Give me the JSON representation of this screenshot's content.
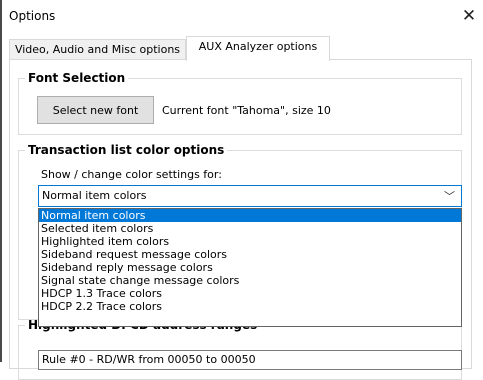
{
  "window": {
    "title": "Options",
    "close_glyph": "✕"
  },
  "tabs": [
    {
      "label": "Video, Audio and Misc options",
      "active": false
    },
    {
      "label": "AUX Analyzer options",
      "active": true
    }
  ],
  "font_selection": {
    "legend": "Font Selection",
    "button_label": "Select new font",
    "current_font_text": "Current font \"Tahoma\", size 10"
  },
  "color_options": {
    "legend": "Transaction list color options",
    "show_label": "Show / change color settings for:",
    "selected_value": "Normal item colors",
    "dropdown_arrow": "﹀",
    "options": [
      {
        "label": "Normal item colors",
        "selected": true
      },
      {
        "label": "Selected item colors",
        "selected": false
      },
      {
        "label": "Highlighted item colors",
        "selected": false
      },
      {
        "label": "Sideband request message colors",
        "selected": false
      },
      {
        "label": "Sideband reply message colors",
        "selected": false
      },
      {
        "label": "Signal state change message colors",
        "selected": false
      },
      {
        "label": "HDCP 1.3 Trace colors",
        "selected": false
      },
      {
        "label": "HDCP 2.2 Trace colors",
        "selected": false
      }
    ]
  },
  "dpcd": {
    "legend": "Highlighted DPCD address ranges",
    "rule_text": "Rule #0 - RD/WR from 00050 to 00050"
  },
  "colors": {
    "accent": "#0078d7",
    "button_bg": "#e1e1e1",
    "border": "#d9d9d9"
  }
}
